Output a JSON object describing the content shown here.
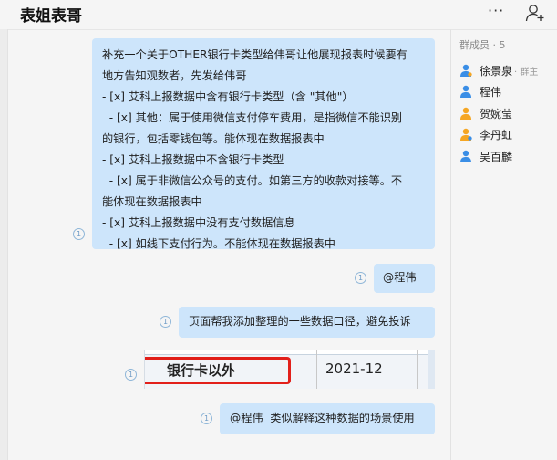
{
  "header": {
    "title": "表姐表哥",
    "more_label": "···"
  },
  "panel": {
    "heading": "群成员 · 5",
    "members": [
      {
        "name": "徐景泉",
        "role": "· 群主",
        "color": "#3a8ee6"
      },
      {
        "name": "程伟",
        "role": "",
        "color": "#3a8ee6"
      },
      {
        "name": "贺婉莹",
        "role": "",
        "color": "#f5a623"
      },
      {
        "name": "李丹虹",
        "role": "",
        "color": "#f5a623"
      },
      {
        "name": "吴百麟",
        "role": "",
        "color": "#3a8ee6"
      }
    ]
  },
  "messages": {
    "m1": {
      "lines": [
        "补充一个关于OTHER银行卡类型给伟哥让他展现报表时候要有",
        "地方告知观数者，先发给伟哥",
        "- [x] 艾科上报数据中含有银行卡类型（含 \"其他\"）",
        "  - [x] 其他：属于使用微信支付停车费用，是指微信不能识别",
        "的银行，包括零钱包等。能体现在数据报表中",
        "- [x] 艾科上报数据中不含银行卡类型",
        "  - [x] 属于非微信公众号的支付。如第三方的收款对接等。不",
        "能体现在数据报表中",
        "- [x] 艾科上报数据中没有支付数据信息",
        "  - [x] 如线下支付行为。不能体现在数据报表中"
      ],
      "read_count": "1"
    },
    "m2": {
      "text": "@程伟",
      "read_count": "1"
    },
    "m3": {
      "text": "页面帮我添加整理的一些数据口径，避免投诉",
      "read_count": "1"
    },
    "m4": {
      "cell1": "银行卡以外",
      "cell2": "2021-12",
      "read_count": "1"
    },
    "m5": {
      "text": "@程伟  类似解释这种数据的场景使用",
      "read_count": "1"
    }
  }
}
